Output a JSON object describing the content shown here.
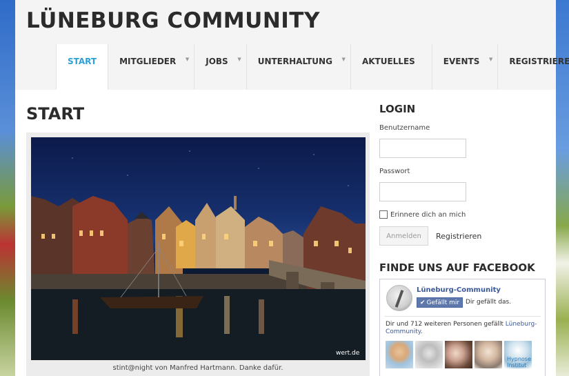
{
  "site": {
    "title": "LÜNEBURG COMMUNITY"
  },
  "nav": {
    "items": [
      {
        "label": "START",
        "active": true,
        "has_dropdown": false
      },
      {
        "label": "MITGLIEDER",
        "active": false,
        "has_dropdown": true
      },
      {
        "label": "JOBS",
        "active": false,
        "has_dropdown": true
      },
      {
        "label": "UNTERHALTUNG",
        "active": false,
        "has_dropdown": true
      },
      {
        "label": "AKTUELLES",
        "active": false,
        "has_dropdown": false
      },
      {
        "label": "EVENTS",
        "active": false,
        "has_dropdown": true
      },
      {
        "label": "REGISTRIEREN",
        "active": false,
        "has_dropdown": false
      }
    ],
    "caret_glyph": "▼"
  },
  "main": {
    "title": "START",
    "photo_watermark": "wert.de",
    "caption": "stint@night von Manfred Hartmann. Danke dafür."
  },
  "login": {
    "heading": "LOGIN",
    "username_label": "Benutzername",
    "username_value": "",
    "password_label": "Passwort",
    "password_value": "",
    "remember_label": "Erinnere dich an mich",
    "remember_checked": false,
    "submit_label": "Anmelden",
    "register_label": "Registrieren"
  },
  "facebook": {
    "heading": "FINDE UNS AUF FACEBOOK",
    "page_name": "Lüneburg-Community",
    "like_button": "Gefällt mir",
    "like_check": "✔",
    "you_like": "Dir gefällt das.",
    "count_text": "Dir und 712 weiteren Personen gefällt ",
    "count_link": "Lüneburg-Community",
    "count_end": ".",
    "face5_text": "Hypnose Institut"
  },
  "colors": {
    "accent": "#2aa0d6",
    "header_bg": "#f4f4f4",
    "facebook_blue": "#3b5998",
    "text_dark": "#2b2b2b"
  }
}
